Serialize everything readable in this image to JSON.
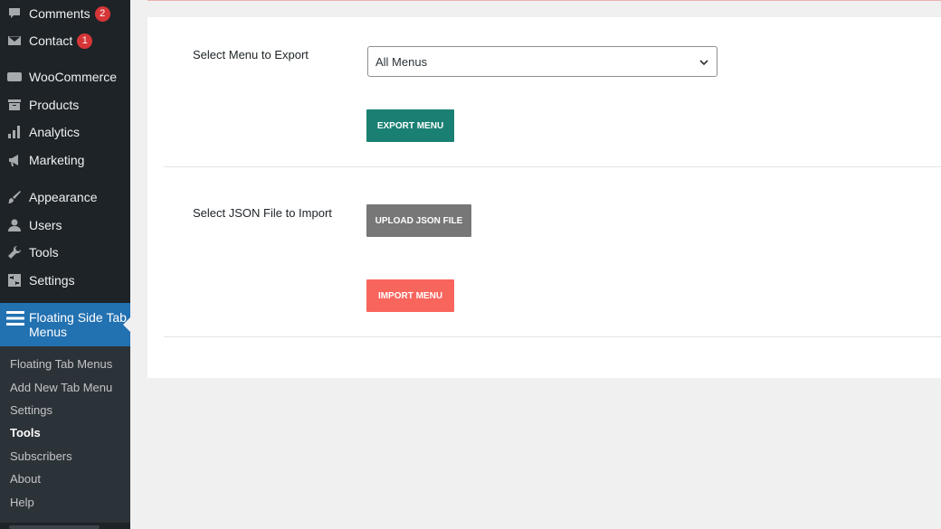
{
  "sidebar": {
    "items": [
      {
        "label": "Comments",
        "icon": "comment-icon",
        "badge": "2"
      },
      {
        "label": "Contact",
        "icon": "mail-icon",
        "badge": "1"
      },
      {
        "label": "WooCommerce",
        "icon": "woocommerce-icon"
      },
      {
        "label": "Products",
        "icon": "archive-icon"
      },
      {
        "label": "Analytics",
        "icon": "bar-chart-icon"
      },
      {
        "label": "Marketing",
        "icon": "megaphone-icon"
      },
      {
        "label": "Appearance",
        "icon": "brush-icon"
      },
      {
        "label": "Users",
        "icon": "user-icon"
      },
      {
        "label": "Tools",
        "icon": "wrench-icon"
      },
      {
        "label": "Settings",
        "icon": "sliders-icon"
      }
    ],
    "active": {
      "label": "Floating Side Tab Menus",
      "icon": "menu-lines-icon"
    },
    "submenu": [
      {
        "label": "Floating Tab Menus"
      },
      {
        "label": "Add New Tab Menu"
      },
      {
        "label": "Settings"
      },
      {
        "label": "Tools",
        "current": true
      },
      {
        "label": "Subscribers"
      },
      {
        "label": "About"
      },
      {
        "label": "Help"
      }
    ]
  },
  "export": {
    "label": "Select Menu to Export",
    "select_value": "All Menus",
    "button": "EXPORT MENU"
  },
  "import": {
    "label": "Select JSON File to Import",
    "upload_button": "UPLOAD JSON FILE",
    "import_button": "IMPORT MENU"
  },
  "colors": {
    "sidebar_bg": "#1d2327",
    "active_bg": "#2271b1",
    "export_button": "#1a8073",
    "upload_button": "#777777",
    "import_button": "#f8655d",
    "badge": "#d63638"
  }
}
